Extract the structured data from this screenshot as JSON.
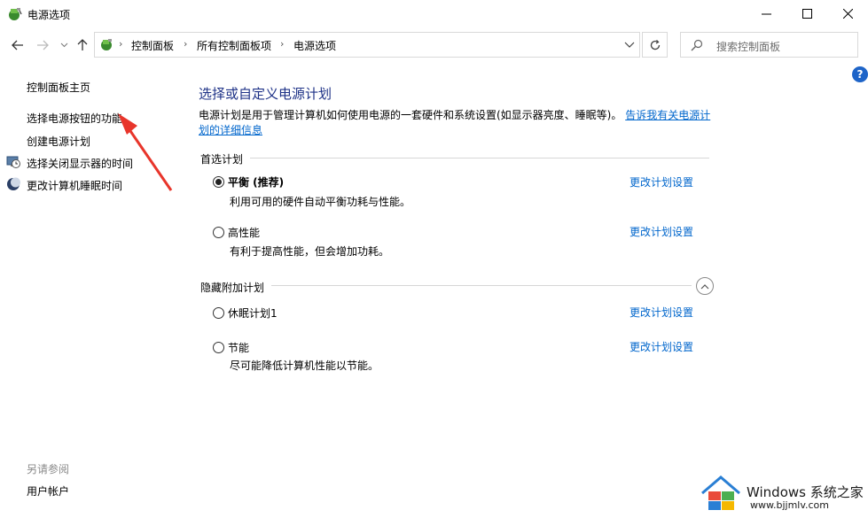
{
  "window": {
    "title": "电源选项",
    "controls": {
      "minimize": "minimize-icon",
      "maximize": "maximize-icon",
      "close": "close-icon"
    }
  },
  "nav": {
    "breadcrumbs": [
      "控制面板",
      "所有控制面板项",
      "电源选项"
    ],
    "search_placeholder": "搜索控制面板",
    "help": "?"
  },
  "sidebar": {
    "home": "控制面板主页",
    "items": [
      {
        "label": "选择电源按钮的功能",
        "icon": ""
      },
      {
        "label": "创建电源计划",
        "icon": ""
      },
      {
        "label": "选择关闭显示器的时间",
        "icon": "monitor-clock-icon"
      },
      {
        "label": "更改计算机睡眠时间",
        "icon": "moon-icon"
      }
    ],
    "see_also_title": "另请参阅",
    "see_also_items": [
      "用户帐户"
    ]
  },
  "main": {
    "title": "选择或自定义电源计划",
    "intro_text": "电源计划是用于管理计算机如何使用电源的一套硬件和系统设置(如显示器亮度、睡眠等)。",
    "intro_link": "告诉我有关电源计划的详细信息",
    "preferred_section": "首选计划",
    "hidden_section": "隐藏附加计划",
    "plans": [
      {
        "name": "平衡 (推荐)",
        "desc": "利用可用的硬件自动平衡功耗与性能。",
        "link": "更改计划设置",
        "selected": true
      },
      {
        "name": "高性能",
        "desc": "有利于提高性能，但会增加功耗。",
        "link": "更改计划设置",
        "selected": false
      },
      {
        "name": "休眠计划1",
        "desc": "",
        "link": "更改计划设置",
        "selected": false
      },
      {
        "name": "节能",
        "desc": "尽可能降低计算机性能以节能。",
        "link": "更改计划设置",
        "selected": false
      }
    ]
  },
  "watermark": {
    "brand": "Windows 系统之家",
    "url": "www.bjjmlv.com"
  },
  "colors": {
    "link": "#0066cc",
    "heading": "#1e3287",
    "annotation_arrow": "#e8352b"
  }
}
